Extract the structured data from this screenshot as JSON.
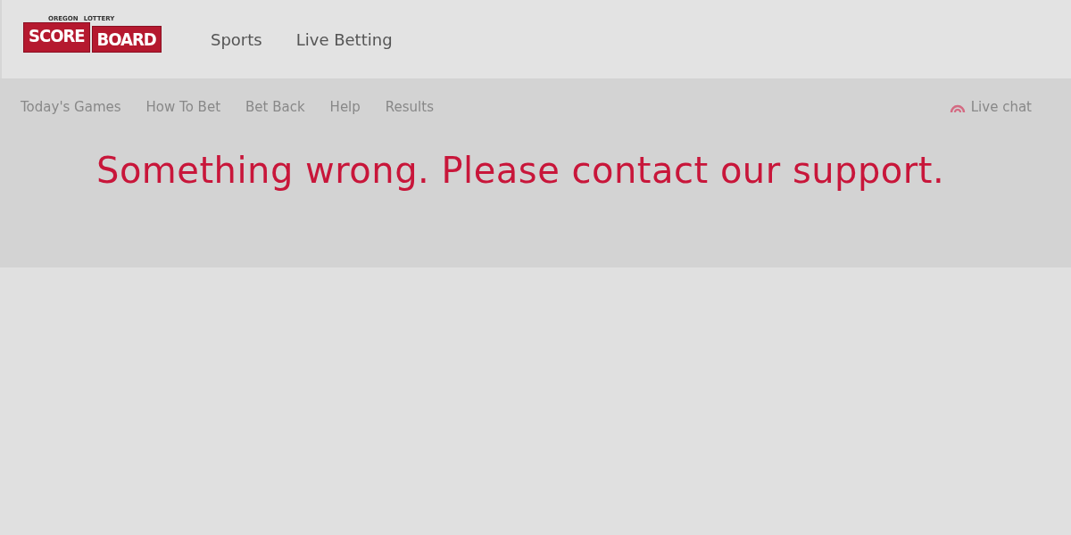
{
  "logo": {
    "top_left": "OREGON",
    "top_right": "LOTTERY",
    "left": "SCORE",
    "right": "BOARD"
  },
  "main_nav": [
    "Sports",
    "Live Betting"
  ],
  "sub_nav": [
    "Today's Games",
    "How To Bet",
    "Bet Back",
    "Help",
    "Results"
  ],
  "live_chat": "Live chat",
  "error_message": "Something wrong. Please contact our support."
}
